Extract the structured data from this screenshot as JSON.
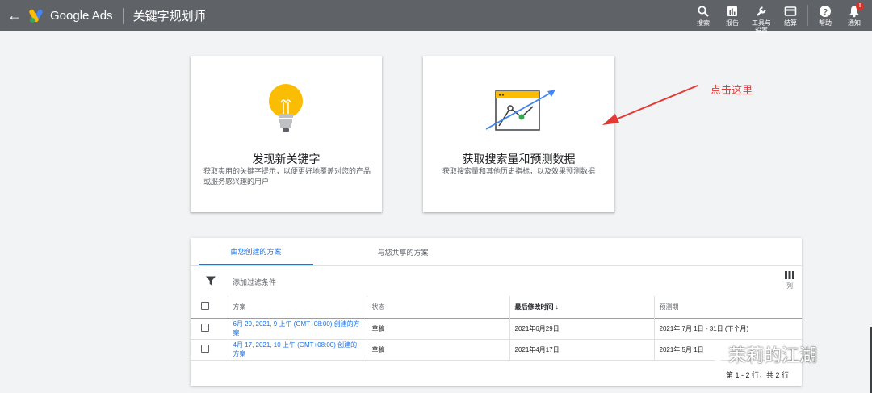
{
  "topbar": {
    "brand": "Google Ads",
    "page_title": "关键字规划师",
    "buttons": [
      {
        "icon": "search-icon",
        "label": "搜索"
      },
      {
        "icon": "reports-icon",
        "label": "报告"
      },
      {
        "icon": "tools-icon",
        "label": "工具与设置"
      },
      {
        "icon": "billing-icon",
        "label": "结算"
      },
      {
        "icon": "help-icon",
        "label": "帮助"
      },
      {
        "icon": "notifications-icon",
        "label": "通知"
      }
    ],
    "notification_badge": "!"
  },
  "cards": [
    {
      "title": "发现新关键字",
      "desc": "获取实用的关键字提示，以便更好地覆盖对您的产品或服务感兴趣的用户",
      "icon": "lightbulb-icon"
    },
    {
      "title": "获取搜索量和预测数据",
      "desc": "获取搜索量和其他历史指标，以及效果预测数据",
      "icon": "trend-chart-icon"
    }
  ],
  "annotation": "点击这里",
  "plans": {
    "tabs": [
      "由您创建的方案",
      "与您共享的方案"
    ],
    "filter_label": "添加过滤条件",
    "columns_label": "列",
    "headers": [
      "方案",
      "状态",
      "最后修改时间",
      "预测期"
    ],
    "sort_indicator": "↓",
    "rows": [
      {
        "plan": "6月 29, 2021, 9 上午 (GMT+08:00) 创建的方案",
        "status": "草稿",
        "modified": "2021年6月29日",
        "period": "2021年 7月 1日 - 31日 (下个月)"
      },
      {
        "plan": "4月 17, 2021, 10 上午 (GMT+08:00) 创建的方案",
        "status": "草稿",
        "modified": "2021年4月17日",
        "period": "2021年 5月 1日"
      }
    ],
    "pagination": "第 1 - 2 行，共 2 行"
  },
  "watermark": "茉莉的江湖",
  "colors": {
    "topbar": "#5f6368",
    "accent": "#1a73e8",
    "annotation": "#e53935",
    "bulb": "#fbbc04"
  }
}
